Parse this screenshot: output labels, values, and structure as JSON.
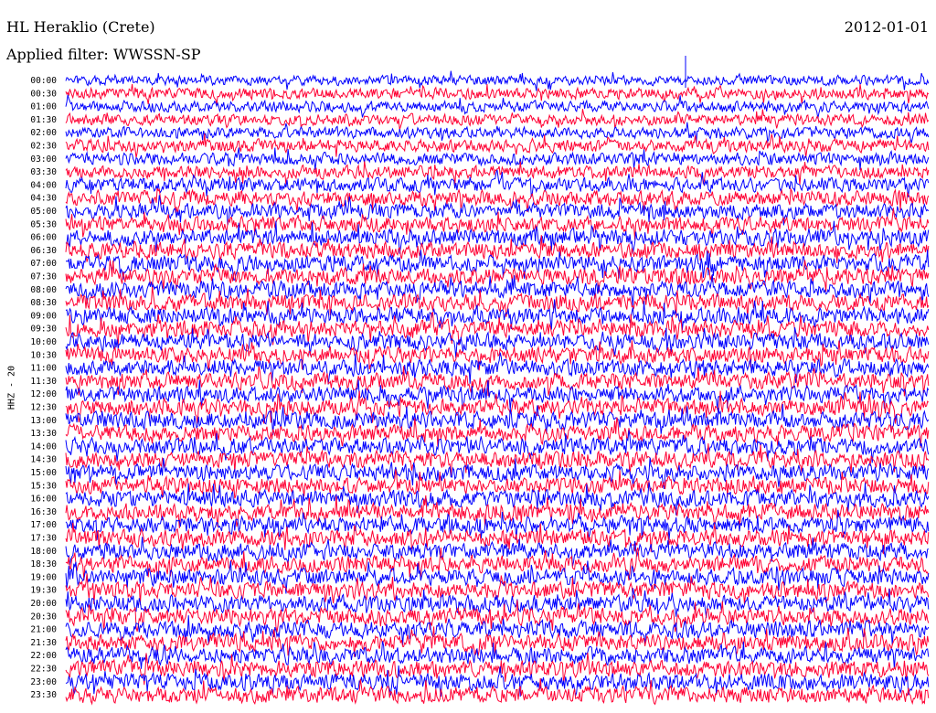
{
  "header": {
    "station": "HL Heraklio (Crete)",
    "date": "2012-01-01",
    "filter": "Applied filter: WWSSN-SP"
  },
  "chart_data": {
    "type": "line",
    "title": "HL Heraklio (Crete)",
    "subtitle": "Applied filter: WWSSN-SP",
    "date": "2012-01-01",
    "ylabel": "HHZ - 20",
    "xlabel": "",
    "row_duration_minutes": 30,
    "series_colors": [
      "#0000ff",
      "#ff0033"
    ],
    "grid": false,
    "rows": [
      {
        "time": "00:00",
        "color": "#0000ff",
        "amplitude": 0.7
      },
      {
        "time": "00:30",
        "color": "#ff0033",
        "amplitude": 0.8
      },
      {
        "time": "01:00",
        "color": "#0000ff",
        "amplitude": 0.8
      },
      {
        "time": "01:30",
        "color": "#ff0033",
        "amplitude": 0.8
      },
      {
        "time": "02:00",
        "color": "#0000ff",
        "amplitude": 0.8
      },
      {
        "time": "02:30",
        "color": "#ff0033",
        "amplitude": 0.9
      },
      {
        "time": "03:00",
        "color": "#0000ff",
        "amplitude": 0.9
      },
      {
        "time": "03:30",
        "color": "#ff0033",
        "amplitude": 0.9
      },
      {
        "time": "04:00",
        "color": "#0000ff",
        "amplitude": 1.0
      },
      {
        "time": "04:30",
        "color": "#ff0033",
        "amplitude": 1.1
      },
      {
        "time": "05:00",
        "color": "#0000ff",
        "amplitude": 1.1
      },
      {
        "time": "05:30",
        "color": "#ff0033",
        "amplitude": 1.1
      },
      {
        "time": "06:00",
        "color": "#0000ff",
        "amplitude": 1.2
      },
      {
        "time": "06:30",
        "color": "#ff0033",
        "amplitude": 1.2
      },
      {
        "time": "07:00",
        "color": "#0000ff",
        "amplitude": 1.2
      },
      {
        "time": "07:30",
        "color": "#ff0033",
        "amplitude": 1.2
      },
      {
        "time": "08:00",
        "color": "#0000ff",
        "amplitude": 1.2
      },
      {
        "time": "08:30",
        "color": "#ff0033",
        "amplitude": 1.2
      },
      {
        "time": "09:00",
        "color": "#0000ff",
        "amplitude": 1.2
      },
      {
        "time": "09:30",
        "color": "#ff0033",
        "amplitude": 1.2
      },
      {
        "time": "10:00",
        "color": "#0000ff",
        "amplitude": 1.2
      },
      {
        "time": "10:30",
        "color": "#ff0033",
        "amplitude": 1.2
      },
      {
        "time": "11:00",
        "color": "#0000ff",
        "amplitude": 1.2
      },
      {
        "time": "11:30",
        "color": "#ff0033",
        "amplitude": 1.2
      },
      {
        "time": "12:00",
        "color": "#0000ff",
        "amplitude": 1.2
      },
      {
        "time": "12:30",
        "color": "#ff0033",
        "amplitude": 1.2
      },
      {
        "time": "13:00",
        "color": "#0000ff",
        "amplitude": 1.2
      },
      {
        "time": "13:30",
        "color": "#ff0033",
        "amplitude": 1.2
      },
      {
        "time": "14:00",
        "color": "#0000ff",
        "amplitude": 1.2
      },
      {
        "time": "14:30",
        "color": "#ff0033",
        "amplitude": 1.2
      },
      {
        "time": "15:00",
        "color": "#0000ff",
        "amplitude": 1.2
      },
      {
        "time": "15:30",
        "color": "#ff0033",
        "amplitude": 1.2
      },
      {
        "time": "16:00",
        "color": "#0000ff",
        "amplitude": 1.2
      },
      {
        "time": "16:30",
        "color": "#ff0033",
        "amplitude": 1.2
      },
      {
        "time": "17:00",
        "color": "#0000ff",
        "amplitude": 1.2
      },
      {
        "time": "17:30",
        "color": "#ff0033",
        "amplitude": 1.2
      },
      {
        "time": "18:00",
        "color": "#0000ff",
        "amplitude": 1.2
      },
      {
        "time": "18:30",
        "color": "#ff0033",
        "amplitude": 1.2
      },
      {
        "time": "19:00",
        "color": "#0000ff",
        "amplitude": 1.2
      },
      {
        "time": "19:30",
        "color": "#ff0033",
        "amplitude": 1.2
      },
      {
        "time": "20:00",
        "color": "#0000ff",
        "amplitude": 1.2
      },
      {
        "time": "20:30",
        "color": "#ff0033",
        "amplitude": 1.2
      },
      {
        "time": "21:00",
        "color": "#0000ff",
        "amplitude": 1.2
      },
      {
        "time": "21:30",
        "color": "#ff0033",
        "amplitude": 1.2
      },
      {
        "time": "22:00",
        "color": "#0000ff",
        "amplitude": 1.2
      },
      {
        "time": "22:30",
        "color": "#ff0033",
        "amplitude": 1.2
      },
      {
        "time": "23:00",
        "color": "#0000ff",
        "amplitude": 1.2
      },
      {
        "time": "23:30",
        "color": "#ff0033",
        "amplitude": 1.2
      }
    ]
  }
}
